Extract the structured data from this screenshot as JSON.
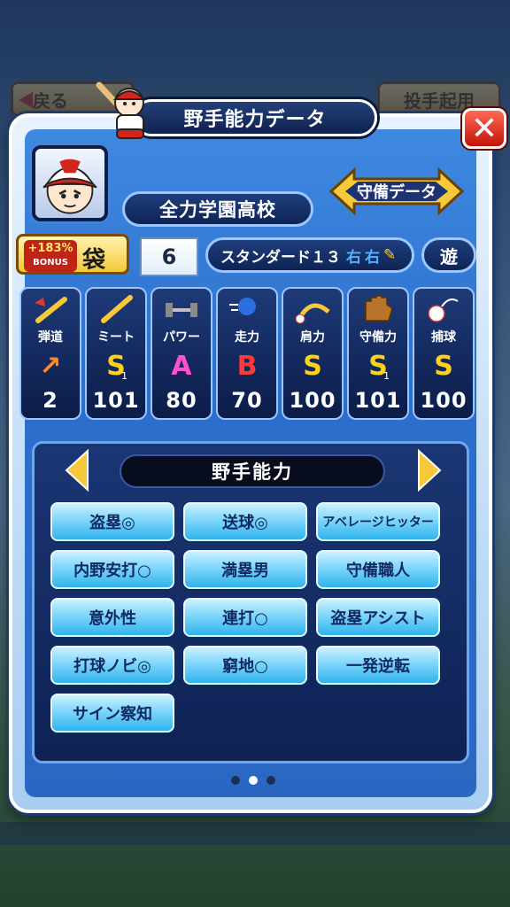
{
  "background": {
    "back_label": "戻る",
    "pitcher_label": "投手起用"
  },
  "header": {
    "title": "野手能力データ",
    "close_icon": "close-icon"
  },
  "profile": {
    "school": "全力学園高校",
    "defense_button": "守備データ",
    "bonus_percent": "+183%",
    "bonus_word": "BONUS",
    "bonus_item": "袋",
    "number": "6",
    "player_type": "スタンダード１３",
    "throws": "右",
    "bats": "右",
    "position": "遊"
  },
  "stats": [
    {
      "name": "弾道",
      "icon": "trajectory-arrow-icon",
      "grade": "↗",
      "grade_color": "#ff8a2a",
      "sub": "",
      "value": "2"
    },
    {
      "name": "ミート",
      "icon": "bat-icon",
      "grade": "S",
      "grade_color": "#ffd21a",
      "sub": "1",
      "value": "101"
    },
    {
      "name": "パワー",
      "icon": "dumbbell-icon",
      "grade": "A",
      "grade_color": "#ff4fcf",
      "sub": "",
      "value": "80"
    },
    {
      "name": "走力",
      "icon": "running-icon",
      "grade": "B",
      "grade_color": "#ff3a3a",
      "sub": "",
      "value": "70"
    },
    {
      "name": "肩力",
      "icon": "throw-arc-icon",
      "grade": "S",
      "grade_color": "#ffd21a",
      "sub": "",
      "value": "100"
    },
    {
      "name": "守備力",
      "icon": "glove-icon",
      "grade": "S",
      "grade_color": "#ffd21a",
      "sub": "1",
      "value": "101"
    },
    {
      "name": "捕球",
      "icon": "catch-ball-icon",
      "grade": "S",
      "grade_color": "#ffd21a",
      "sub": "",
      "value": "100"
    }
  ],
  "skills_section": {
    "title": "野手能力",
    "skills": [
      "盗塁◎",
      "送球◎",
      "アベレージヒッター",
      "内野安打○",
      "満塁男",
      "守備職人",
      "意外性",
      "連打○",
      "盗塁アシスト",
      "打球ノビ◎",
      "窮地○",
      "一発逆転",
      "サイン察知"
    ]
  },
  "pagination": {
    "total": 3,
    "active": 2
  }
}
